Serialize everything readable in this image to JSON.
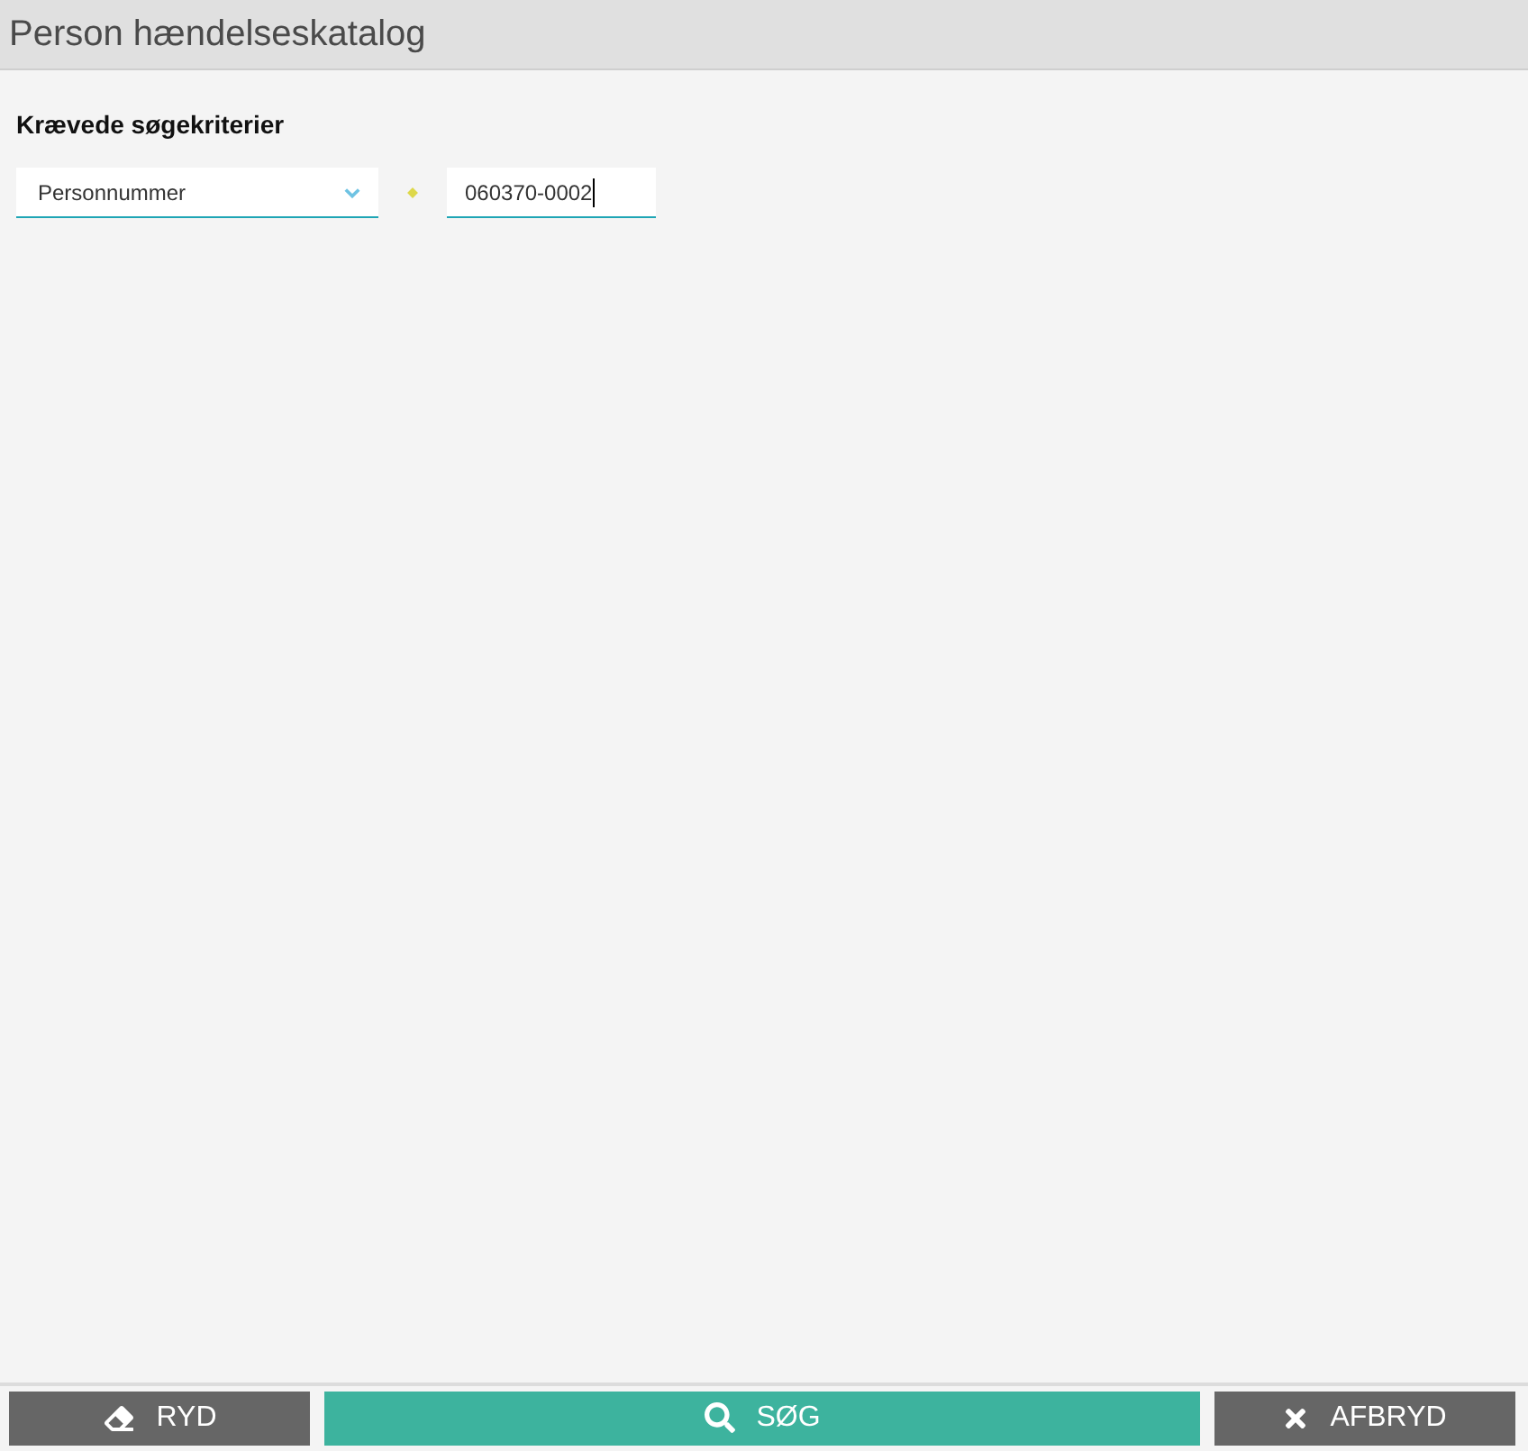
{
  "window": {
    "title": "Person hændelseskatalog"
  },
  "criteria": {
    "heading": "Krævede søgekriterier",
    "select": {
      "value": "Personnummer"
    },
    "input": {
      "value": "060370-0002",
      "required": true,
      "focused": true
    }
  },
  "buttons": [
    {
      "kind": "clear",
      "label": "RYD"
    },
    {
      "kind": "search",
      "label": "SØG"
    },
    {
      "kind": "cancel",
      "label": "AFBRYD"
    }
  ]
}
